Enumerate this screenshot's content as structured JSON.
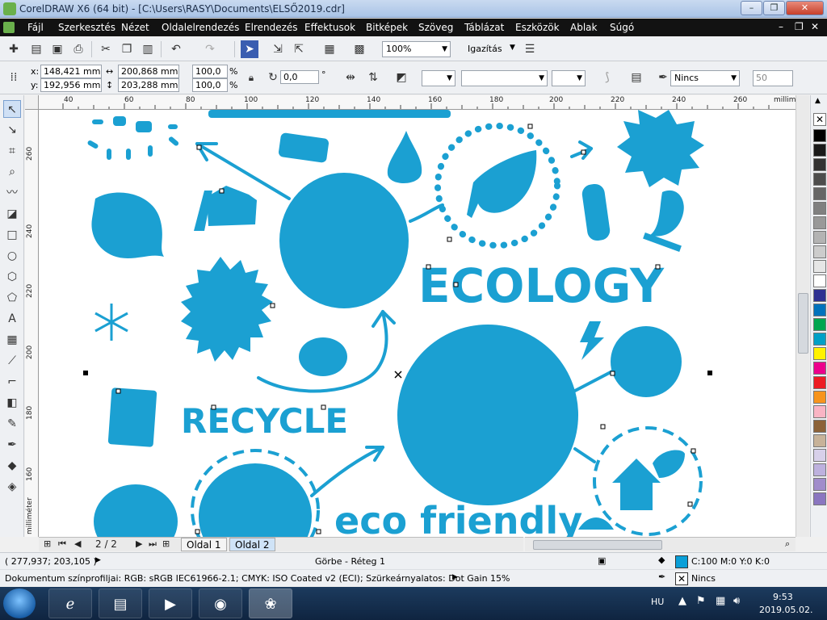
{
  "window": {
    "title": "CorelDRAW X6 (64 bit) - [C:\\Users\\RASY\\Documents\\ELSŐ2019.cdr]",
    "minimize_label": "–",
    "maximize_label": "❐",
    "close_label": "✕",
    "doc_min_label": "–",
    "doc_restore_label": "❐",
    "doc_close_label": "✕"
  },
  "menu": {
    "items": [
      "Fájl",
      "Szerkesztés",
      "Nézet",
      "Oldalelrendezés",
      "Elrendezés",
      "Effektusok",
      "Bitképek",
      "Szöveg",
      "Táblázat",
      "Eszközök",
      "Ablak",
      "Súgó"
    ]
  },
  "toolbar": {
    "zoom_value": "100%",
    "snap_label": "Igazítás"
  },
  "property_bar": {
    "x_label": "x:",
    "x_value": "148,421 mm",
    "y_label": "y:",
    "y_value": "192,956 mm",
    "width_value": "200,868 mm",
    "height_value": "203,288 mm",
    "scale_x": "100,0",
    "scale_y": "100,0",
    "percent": "%",
    "rotation": "0,0",
    "degree": "°",
    "outline_style": "Nincs",
    "outline_width": "50"
  },
  "rulers": {
    "horizontal_ticks": [
      "40",
      "60",
      "80",
      "100",
      "120",
      "140",
      "160",
      "180",
      "200",
      "220",
      "240",
      "260"
    ],
    "horizontal_unit": "milliméter",
    "vertical_ticks": [
      "260",
      "240",
      "220",
      "200",
      "180",
      "160"
    ],
    "vertical_unit": "milliméter"
  },
  "canvas": {
    "ecology_text": "ECOLOGY",
    "recycle_text": "RECYCLE",
    "eco_friendly_text": "eco friendly",
    "shape_color": "#1ba0d2"
  },
  "palette": {
    "colors": [
      "#ffffff",
      "#000000",
      "#1a1a1a",
      "#333333",
      "#4d4d4d",
      "#666666",
      "#808080",
      "#999999",
      "#b3b3b3",
      "#cccccc",
      "#e6e6e6",
      "#ffffff",
      "#2e3192",
      "#0072bc",
      "#00a650",
      "#00a0c6",
      "#fff200",
      "#ec008c",
      "#ed1c24",
      "#f7941d",
      "#f9b4c4",
      "#8c6239",
      "#c7b299",
      "#d7d0ea",
      "#bdb1de",
      "#a08ccb",
      "#8a76c0"
    ]
  },
  "page_nav": {
    "page_counter": "2 / 2",
    "tabs": [
      "Oldal 1",
      "Oldal 2"
    ]
  },
  "status": {
    "coords": "( 277,937; 203,105 )",
    "object_info": "Görbe - Réteg 1",
    "fill_info": "C:100 M:0 Y:0 K:0",
    "outline_info": "Nincs",
    "fill_color": "#0a9fd8",
    "color_profile": "Dokumentum színprofiljai: RGB: sRGB IEC61966-2.1; CMYK: ISO Coated v2 (ECI); Szürkeárnyalatos: Dot Gain 15%"
  },
  "taskbar": {
    "language": "HU",
    "time": "9:53",
    "date": "2019.05.02."
  }
}
